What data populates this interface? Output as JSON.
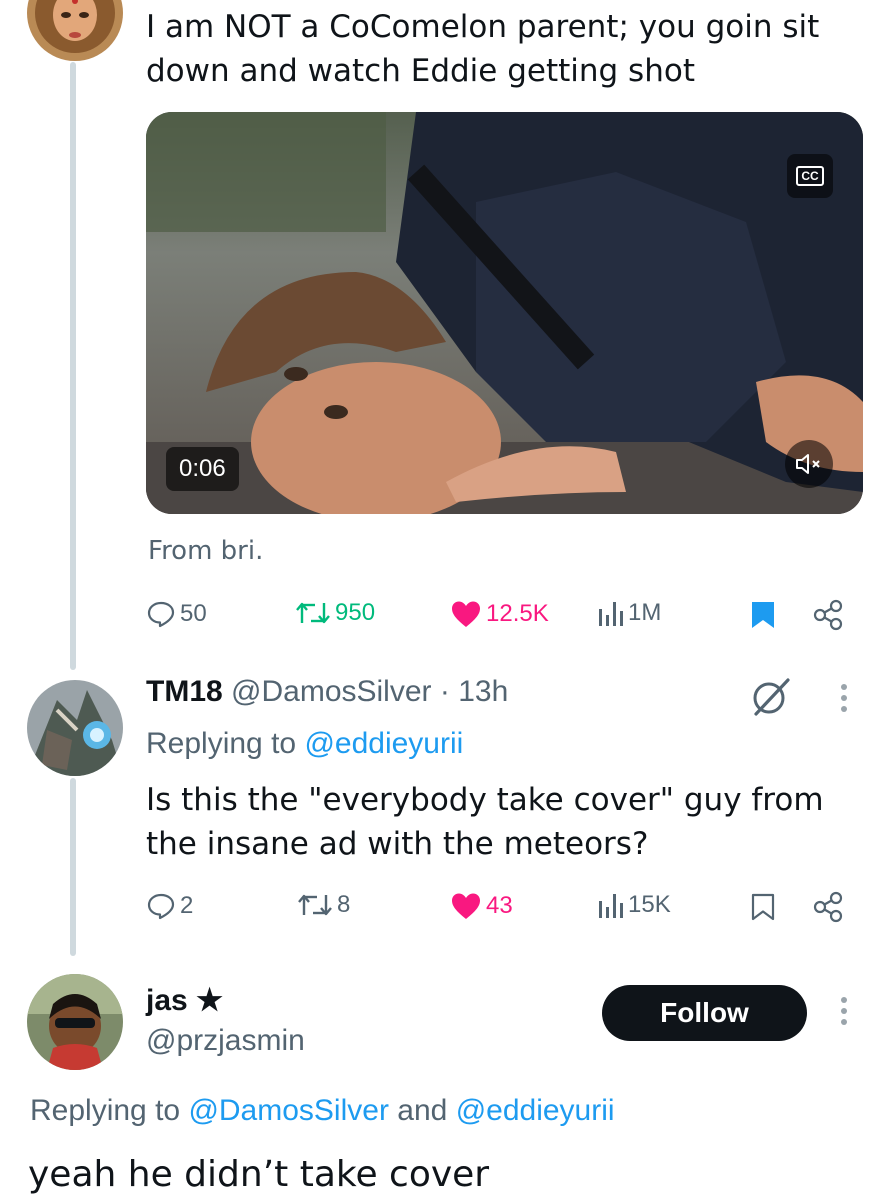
{
  "tweet1": {
    "text_line1": "I am NOT a CoComelon parent; you goin sit",
    "text_line2": "down and watch Eddie getting shot",
    "video": {
      "duration": "0:06",
      "cc_label": "CC"
    },
    "from_label": "From bri.",
    "stats": {
      "replies": "50",
      "retweets": "950",
      "likes": "12.5K",
      "views": "1M"
    },
    "colors": {
      "retweet_active": "#00ba7c",
      "like_active": "#f91880",
      "bookmark_active": "#1d9bf0"
    }
  },
  "tweet2": {
    "display_name": "TM18",
    "handle": "@DamosSilver",
    "separator": "·",
    "time": "13h",
    "replying_prefix": "Replying to",
    "replying_to": "@eddieyurii",
    "text_line1": "Is this the \"everybody take cover\" guy from",
    "text_line2": "the insane ad with the meteors?",
    "stats": {
      "replies": "2",
      "retweets": "8",
      "likes": "43",
      "views": "15K"
    }
  },
  "tweet3": {
    "display_name": "jas",
    "name_star": "★",
    "handle": "@przjasmin",
    "follow_label": "Follow",
    "replying_prefix": "Replying to",
    "replying_to_1": "@DamosSilver",
    "replying_and": "and",
    "replying_to_2": "@eddieyurii",
    "text": "yeah he didn’t take cover"
  }
}
